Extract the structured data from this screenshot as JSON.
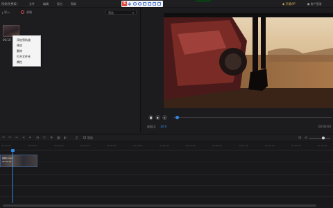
{
  "titlebar": {
    "app_title": "视频(免费版)",
    "menu": [
      "文件",
      "编辑",
      "导出",
      "帮助"
    ],
    "ime_text": "中",
    "account": "开通VIP",
    "user": "账户登录"
  },
  "media": {
    "import_label": "导入",
    "record_label": "录制",
    "sort_value": "筛选",
    "thumb_name": "00:16",
    "context_menu": [
      "添加到轨道",
      "预览",
      "删除",
      "打开文件夹",
      "属性"
    ]
  },
  "preview": {
    "ratio_label": "画面比:",
    "ratio_value": "16:9",
    "time_value": "00:00:00",
    "progress_fraction": 0.02
  },
  "timeline": {
    "export_label": "导出",
    "ruler": [
      "00:00:00",
      "00:00:10",
      "00:00:20",
      "00:00:30",
      "00:00:40",
      "00:00:50",
      "00:01:00",
      "00:01:10",
      "00:01:20",
      "00:01:30",
      "00:01:40",
      "00:01:50",
      "00:02:00"
    ],
    "clip_name": "视频1.mp4",
    "clip_sub": "00:00:16"
  },
  "colors": {
    "accent": "#2d89e6",
    "record": "#d24545",
    "ime_red": "#e8473b"
  }
}
